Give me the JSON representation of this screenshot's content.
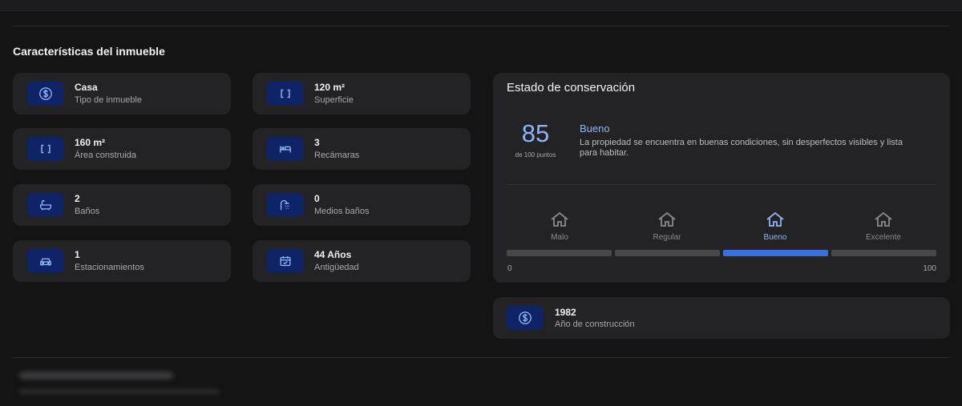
{
  "section": {
    "title": "Características del inmueble"
  },
  "features": [
    {
      "value": "Casa",
      "label": "Tipo de inmueble",
      "icon": "dollar-circle-icon"
    },
    {
      "value": "120 m²",
      "label": "Superficie",
      "icon": "brackets-icon"
    },
    {
      "value": "160 m²",
      "label": "Área construida",
      "icon": "brackets-icon"
    },
    {
      "value": "3",
      "label": "Recámaras",
      "icon": "bed-icon"
    },
    {
      "value": "2",
      "label": "Baños",
      "icon": "bathtub-icon"
    },
    {
      "value": "0",
      "label": "Medios baños",
      "icon": "shower-icon"
    },
    {
      "value": "1",
      "label": "Estacionamientos",
      "icon": "car-icon"
    },
    {
      "value": "44 Años",
      "label": "Antigüedad",
      "icon": "calendar-check-icon"
    }
  ],
  "conservation": {
    "title": "Estado de conservación",
    "score": "85",
    "score_sub": "de 100 puntos",
    "rating": "Bueno",
    "description": "La propiedad se encuentra en buenas condiciones, sin desperfectos visibles y lista para habitar.",
    "levels": [
      "Malo",
      "Regular",
      "Bueno",
      "Excelente"
    ],
    "active_level": "Bueno",
    "scale_min": "0",
    "scale_max": "100"
  },
  "construction": {
    "value": "1982",
    "label": "Año de construcción",
    "icon": "dollar-circle-icon"
  },
  "colors": {
    "background": "#141414",
    "card": "#232325",
    "icon_box": "#0f2466",
    "accent": "#3a6fe0",
    "accent_text": "#8fb4f5"
  }
}
